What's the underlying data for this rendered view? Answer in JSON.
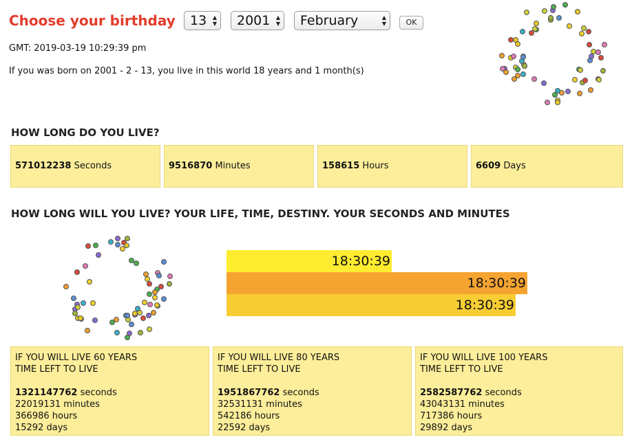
{
  "header": {
    "title": "Choose your birthday",
    "day_select": {
      "value": "13"
    },
    "year_select": {
      "value": "2001"
    },
    "month_select": {
      "value": "February"
    },
    "ok_label": "OK"
  },
  "info": {
    "gmt_line": "GMT: 2019-03-19 10:29:39 pm",
    "born_line": "If you was born on 2001 - 2 - 13, you live in this world 18 years and 1 month(s)"
  },
  "section1": {
    "heading": "HOW LONG DO YOU LIVE?",
    "stats": [
      {
        "value": "571012238",
        "unit": "Seconds"
      },
      {
        "value": "9516870",
        "unit": "Minutes"
      },
      {
        "value": "158615",
        "unit": "Hours"
      },
      {
        "value": "6609",
        "unit": "Days"
      }
    ]
  },
  "section2": {
    "heading": "HOW LONG WILL YOU LIVE? YOUR LIFE, TIME, DESTINY. YOUR SECONDS AND MINUTES",
    "clocks": [
      "18:30:39",
      "18:30:39",
      "18:30:39"
    ],
    "clock_colors": [
      "#fdec2f",
      "#f5a431",
      "#f7cd33"
    ],
    "clock_fill_fractions": [
      0.55,
      1.0,
      0.96
    ],
    "scenarios": [
      {
        "title": "IF YOU WILL LIVE 60 YEARS",
        "subtitle": "TIME LEFT TO LIVE",
        "seconds": "1321147762",
        "seconds_unit": "seconds",
        "minutes": "22019131 minutes",
        "hours": "366986 hours",
        "days": "15292 days"
      },
      {
        "title": "IF YOU WILL LIVE 80 YEARS",
        "subtitle": "TIME LEFT TO LIVE",
        "seconds": "1951867762",
        "seconds_unit": "seconds",
        "minutes": "32531131 minutes",
        "hours": "542186 hours",
        "days": "22592 days"
      },
      {
        "title": "IF YOU WILL LIVE 100 YEARS",
        "subtitle": "TIME LEFT TO LIVE",
        "seconds": "2582587762",
        "seconds_unit": "seconds",
        "minutes": "43043131 minutes",
        "hours": "717386 hours",
        "days": "29892 days"
      }
    ]
  },
  "colors": {
    "title": "#e23c2c",
    "box_background": "#fcee9a"
  },
  "decorations": {
    "emoji_ring_icon": "emoji-ring-icon"
  }
}
